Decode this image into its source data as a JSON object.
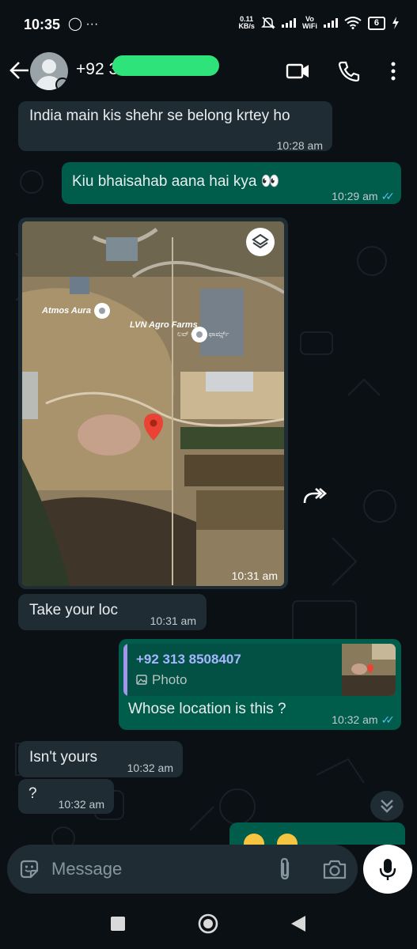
{
  "status_bar": {
    "time": "10:35",
    "extra": "◯ ···",
    "net_speed_value": "0.11",
    "net_speed_unit": "KB/s",
    "vowifi_top": "Vo",
    "vowifi_bottom": "WiFi",
    "battery": "6"
  },
  "header": {
    "contact_visible": "+92 3"
  },
  "messages": {
    "m1": {
      "text": "India main kis shehr se belong krtey ho",
      "time": "10:28 am"
    },
    "m2": {
      "text": "Kiu bhaisahab aana hai kya 👀",
      "time": "10:29 am"
    },
    "m3": {
      "time": "10:31 am",
      "labels": {
        "atmos": "Atmos Aura",
        "lvn": "LVN Agro Farms",
        "lvn_local": "ಲವ್ ಅಗ್ರೋ ಫಾರ್ಮ್ಸ್"
      }
    },
    "m4": {
      "text": "Take your loc",
      "time": "10:31 am"
    },
    "m5": {
      "quote_name": "+92 313 8508407",
      "quote_type": "Photo",
      "text": "Whose location is this ?",
      "time": "10:32 am"
    },
    "m6": {
      "text": "Isn't yours",
      "time": "10:32 am"
    },
    "m7": {
      "text": "?",
      "time": "10:32 am"
    }
  },
  "input": {
    "placeholder": "Message"
  },
  "icons": [
    "back-arrow-icon",
    "video-call-icon",
    "phone-icon",
    "more-icon",
    "map-layers-icon",
    "location-pin-icon",
    "forward-icon",
    "chevron-double-down-icon",
    "sticker-icon",
    "attach-icon",
    "camera-icon",
    "mic-icon",
    "nav-square-icon",
    "nav-circle-icon",
    "nav-back-icon"
  ],
  "colors": {
    "incoming": "#202c33",
    "outgoing": "#005c4b",
    "read_ticks": "#53bdeb",
    "background": "#0b1014"
  }
}
